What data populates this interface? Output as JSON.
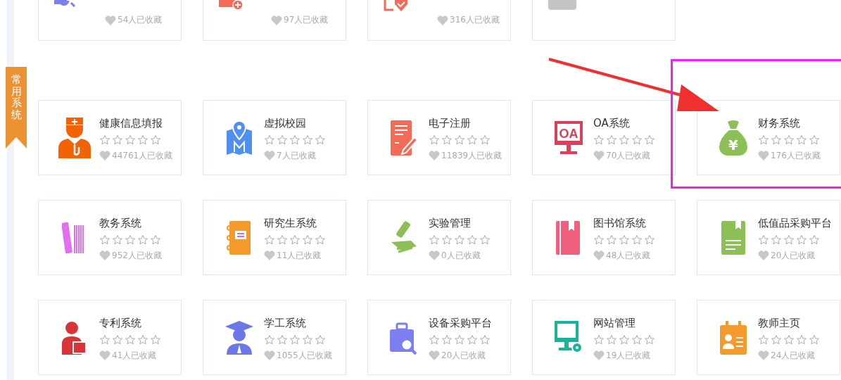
{
  "ribbon": {
    "label": "常用系统"
  },
  "partial_cards": [
    {
      "kind": "app",
      "count": "54人已收藏"
    },
    {
      "kind": "app",
      "count": "97人已收藏"
    },
    {
      "kind": "app",
      "count": "316人已收藏"
    },
    {
      "kind": "blank"
    }
  ],
  "cards": [
    {
      "name": "健康信息填报",
      "stars": 0,
      "count": "44761人已收藏"
    },
    {
      "name": "虚拟校园",
      "stars": 0,
      "count": "7人已收藏"
    },
    {
      "name": "电子注册",
      "stars": 0,
      "count": "11839人已收藏"
    },
    {
      "name": "OA系统",
      "stars": 0,
      "count": "70人已收藏",
      "icon_text": "OA"
    },
    {
      "name": "财务系统",
      "stars": 0,
      "count": "176人已收藏",
      "icon_text": "¥"
    },
    {
      "name": "教务系统",
      "stars": 0,
      "count": "952人已收藏"
    },
    {
      "name": "研究生系统",
      "stars": 0,
      "count": "11人已收藏"
    },
    {
      "name": "实验管理",
      "stars": 0,
      "count": "0人已收藏"
    },
    {
      "name": "图书馆系统",
      "stars": 0,
      "count": "48人已收藏"
    },
    {
      "name": "低值品采购平台",
      "stars": 0,
      "count": "20人已收藏"
    },
    {
      "name": "专利系统",
      "stars": 0,
      "count": "41人已收藏"
    },
    {
      "name": "学工系统",
      "stars": 0,
      "count": "1055人已收藏"
    },
    {
      "name": "设备采购平台",
      "stars": 0,
      "count": "20人已收藏"
    },
    {
      "name": "网站管理",
      "stars": 0,
      "count": "19人已收藏"
    },
    {
      "name": "教师主页",
      "stars": 0,
      "count": "24人已收藏"
    }
  ]
}
